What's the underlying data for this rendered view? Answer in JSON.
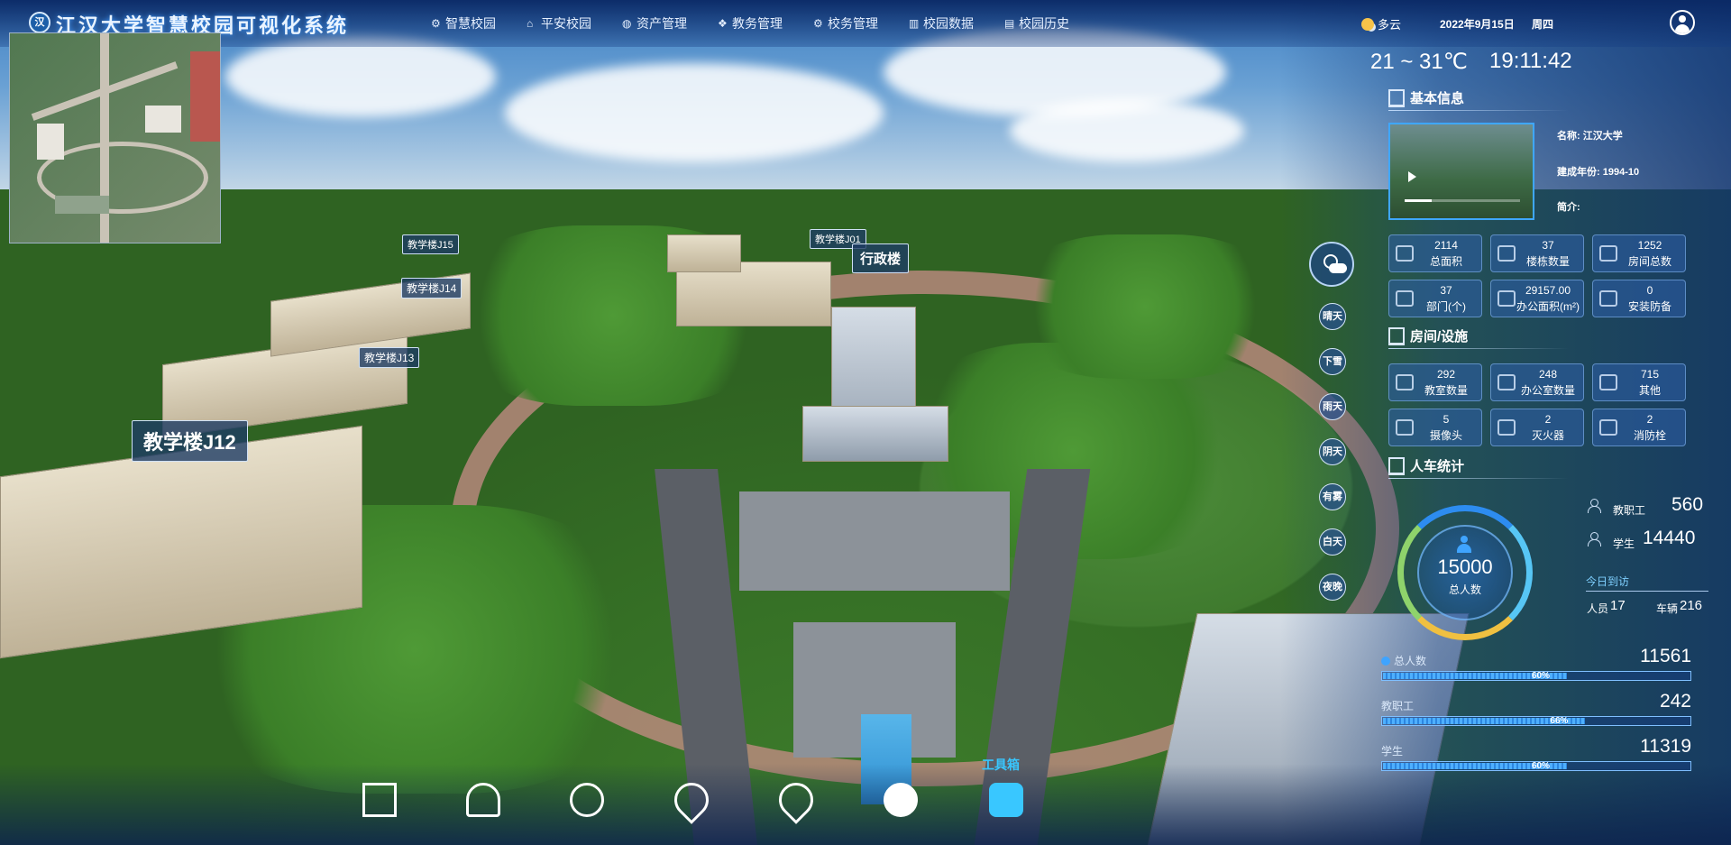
{
  "header": {
    "logo_text": "汉",
    "system_title": "江汉大学智慧校园可视化系统",
    "nav": [
      {
        "icon": "network-icon",
        "label": "智慧校园"
      },
      {
        "icon": "bank-icon",
        "label": "平安校园"
      },
      {
        "icon": "database-icon",
        "label": "资产管理"
      },
      {
        "icon": "cubes-icon",
        "label": "教务管理"
      },
      {
        "icon": "network-icon",
        "label": "校务管理"
      },
      {
        "icon": "bar-chart-icon",
        "label": "校园数据"
      },
      {
        "icon": "document-icon",
        "label": "校园历史"
      }
    ],
    "weather": "多云",
    "date": "2022年9月15日",
    "weekday": "周四"
  },
  "scene": {
    "building_labels": {
      "admin": "行政楼",
      "j12": "教学楼J12",
      "j13": "教学楼J13",
      "j14": "教学楼J14",
      "j15": "教学楼J15",
      "j01": "教学楼J01"
    }
  },
  "right_panel": {
    "temperature": "21 ~ 31℃",
    "time": "19:11:42",
    "basic_info": {
      "title": "基本信息",
      "name": "名称: 江汉大学",
      "founded": "建成年份: 1994-10",
      "intro": "简介:",
      "stats": [
        {
          "icon": "area-icon",
          "value": "2114",
          "label": "总面积"
        },
        {
          "icon": "layers-icon",
          "value": "37",
          "label": "楼栋数量"
        },
        {
          "icon": "home-icon",
          "value": "1252",
          "label": "房间总数"
        },
        {
          "icon": "org-icon",
          "value": "37",
          "label": "部门(个)"
        },
        {
          "icon": "office-area-icon",
          "value": "29157.00",
          "label": "办公面积(m²)"
        },
        {
          "icon": "shield-icon",
          "value": "0",
          "label": "安装防备"
        }
      ]
    },
    "facilities": {
      "title": "房间/设施",
      "stats": [
        {
          "icon": "classroom-icon",
          "value": "292",
          "label": "教室数量"
        },
        {
          "icon": "office-icon",
          "value": "248",
          "label": "办公室数量"
        },
        {
          "icon": "list-icon",
          "value": "715",
          "label": "其他"
        },
        {
          "icon": "camera-icon",
          "value": "5",
          "label": "摄像头"
        },
        {
          "icon": "extinguisher-icon",
          "value": "2",
          "label": "灭火器"
        },
        {
          "icon": "hydrant-icon",
          "value": "2",
          "label": "消防栓"
        }
      ]
    },
    "people": {
      "title": "人车统计",
      "total": "15000",
      "total_label": "总人数",
      "staff_label": "教职工",
      "staff": "560",
      "students_label": "学生",
      "students": "14440",
      "visit_title": "今日到访",
      "visitors_label": "人员",
      "visitors": "17",
      "vehicles_label": "车辆",
      "vehicles": "216"
    },
    "progress": [
      {
        "label": "总人数",
        "value": "11561",
        "percent": 60,
        "percent_text": "60%"
      },
      {
        "label": "教职工",
        "value": "242",
        "percent": 66,
        "percent_text": "66%"
      },
      {
        "label": "学生",
        "value": "11319",
        "percent": 60,
        "percent_text": "60%"
      }
    ]
  },
  "weather_buttons": [
    "晴天",
    "下雪",
    "雨天",
    "阴天",
    "有雾",
    "白天",
    "夜晚"
  ],
  "toolbar": {
    "label": "工具箱",
    "tools": [
      "rotate-cube-icon",
      "person-pin-icon",
      "refresh-globe-icon",
      "map-pin-icon",
      "location-search-icon",
      "medical-kit-icon",
      "toolbox-icon"
    ]
  },
  "colors": {
    "accent": "#2d8cf0",
    "header_bg": "#0a2864",
    "tool_active": "#39c7ff"
  }
}
